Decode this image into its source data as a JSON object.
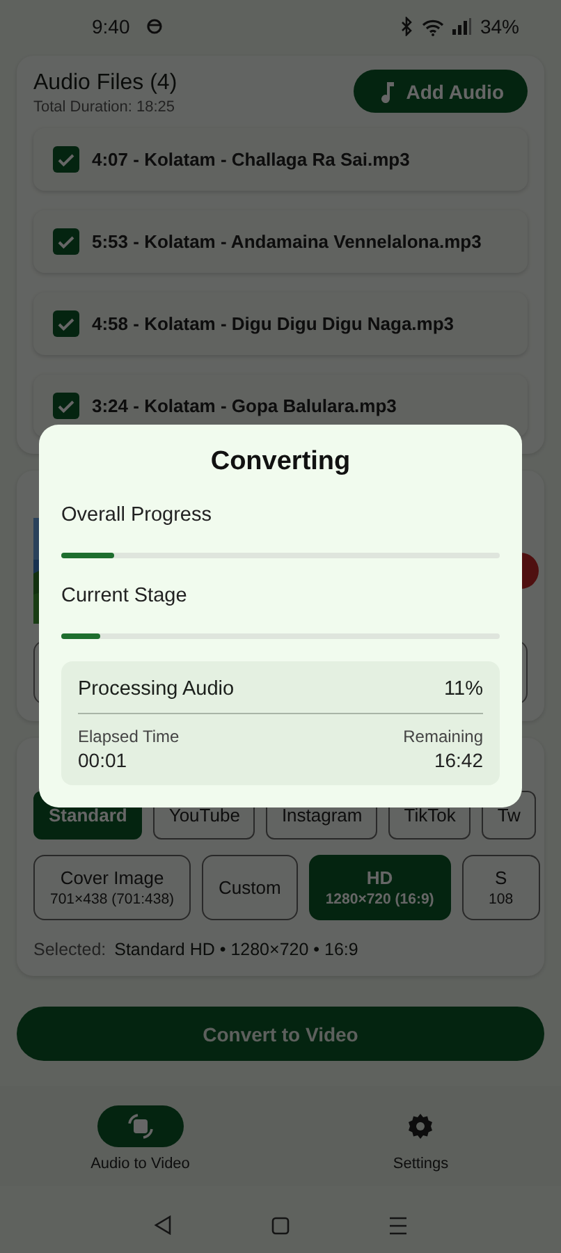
{
  "status_bar": {
    "time": "9:40",
    "battery": "34%"
  },
  "audio_files": {
    "title": "Audio Files (4)",
    "total_duration": "Total Duration: 18:25",
    "add_button": "Add Audio",
    "items": [
      {
        "label": "4:07 - Kolatam - Challaga Ra Sai.mp3",
        "checked": true
      },
      {
        "label": "5:53 - Kolatam - Andamaina Vennelalona.mp3",
        "checked": true
      },
      {
        "label": "4:58 - Kolatam - Digu Digu Digu Naga.mp3",
        "checked": true
      },
      {
        "label": "3:24 - Kolatam - Gopa Balulara.mp3",
        "checked": true
      }
    ]
  },
  "video_section": {
    "platforms": [
      {
        "label": "Standard",
        "selected": true
      },
      {
        "label": "YouTube",
        "selected": false
      },
      {
        "label": "Instagram",
        "selected": false
      },
      {
        "label": "TikTok",
        "selected": false
      },
      {
        "label": "Tw",
        "selected": false
      }
    ],
    "resolutions": [
      {
        "label": "Cover Image",
        "detail": "701×438 (701:438)",
        "selected": false
      },
      {
        "label": "Custom",
        "selected": false
      },
      {
        "label": "HD",
        "detail": "1280×720 (16:9)",
        "selected": true
      },
      {
        "label": "S",
        "detail": "108",
        "selected": false
      }
    ],
    "selected_label": "Selected:",
    "selected_value": "Standard HD • 1280×720 • 16:9"
  },
  "convert_button": "Convert to Video",
  "bottom_nav": [
    {
      "label": "Audio to Video",
      "selected": true,
      "kind": "convert"
    },
    {
      "label": "Settings",
      "selected": false,
      "kind": "settings"
    }
  ],
  "dialog": {
    "title": "Converting",
    "overall": {
      "label": "Overall Progress",
      "level": 0.12
    },
    "stage": {
      "label": "Current Stage",
      "level": 0.09
    },
    "stage_name": "Processing Audio",
    "percent": "11%",
    "elapsed_label": "Elapsed Time",
    "elapsed": "00:01",
    "remaining_label": "Remaining",
    "remaining": "16:42"
  }
}
